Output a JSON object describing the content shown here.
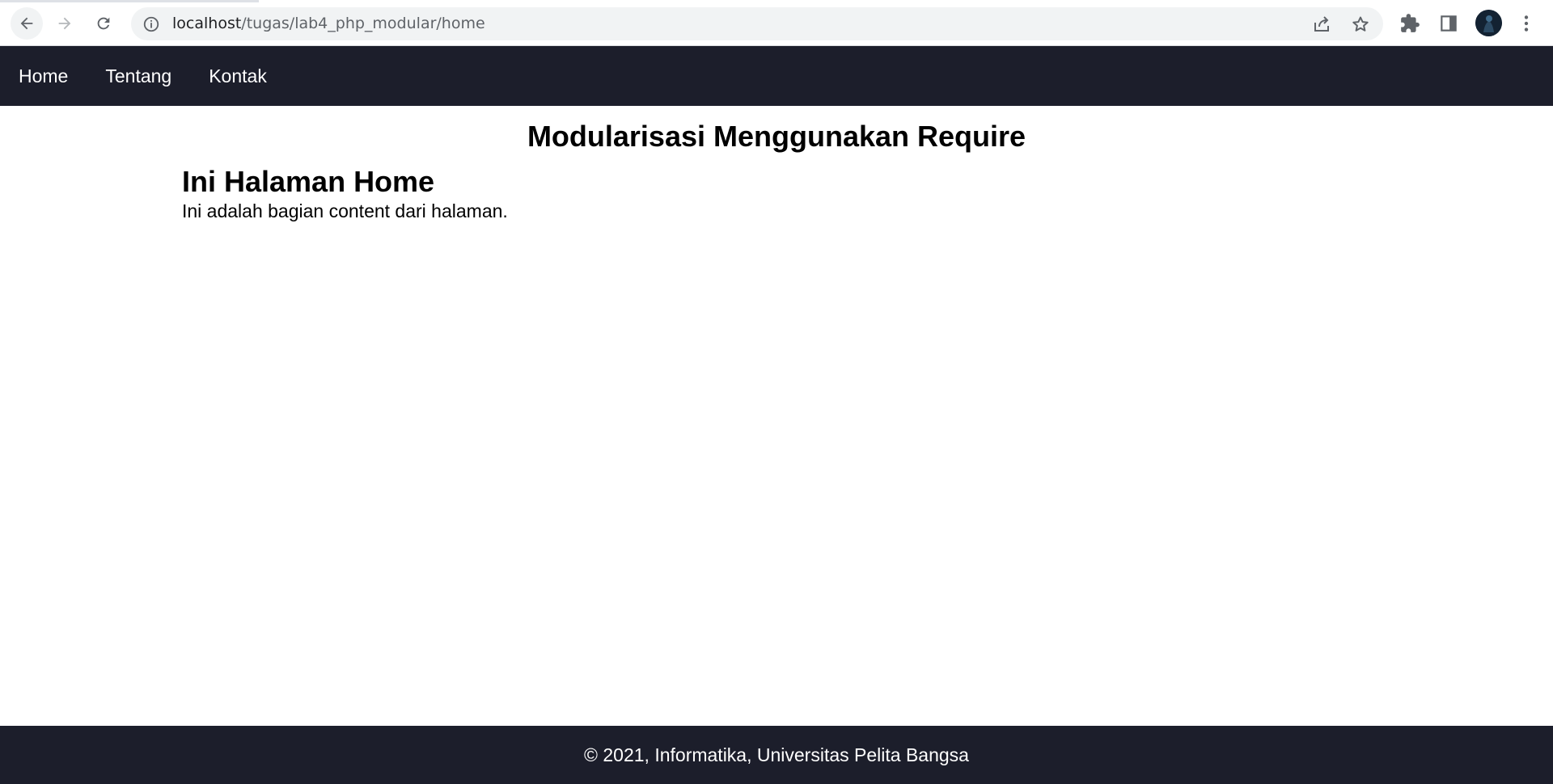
{
  "browser": {
    "url_host": "localhost",
    "url_path": "/tugas/lab4_php_modular/home"
  },
  "icons": {
    "back": "arrow-left-icon",
    "forward": "arrow-right-icon",
    "reload": "reload-icon",
    "info": "info-icon",
    "share": "share-icon",
    "bookmark": "star-icon",
    "extensions": "puzzle-icon",
    "side_panel": "side-panel-icon",
    "profile": "avatar",
    "menu": "kebab-menu-icon"
  },
  "nav": {
    "items": [
      {
        "label": "Home"
      },
      {
        "label": "Tentang"
      },
      {
        "label": "Kontak"
      }
    ]
  },
  "page": {
    "heading": "Modularisasi Menggunakan Require",
    "content_title": "Ini Halaman Home",
    "content_text": "Ini adalah bagian content dari halaman."
  },
  "footer": {
    "text": "© 2021, Informatika, Universitas Pelita Bangsa"
  },
  "colors": {
    "nav_bg": "#1c1e2b",
    "footer_bg": "#1c1e2b",
    "omnibox_bg": "#f1f3f4"
  }
}
